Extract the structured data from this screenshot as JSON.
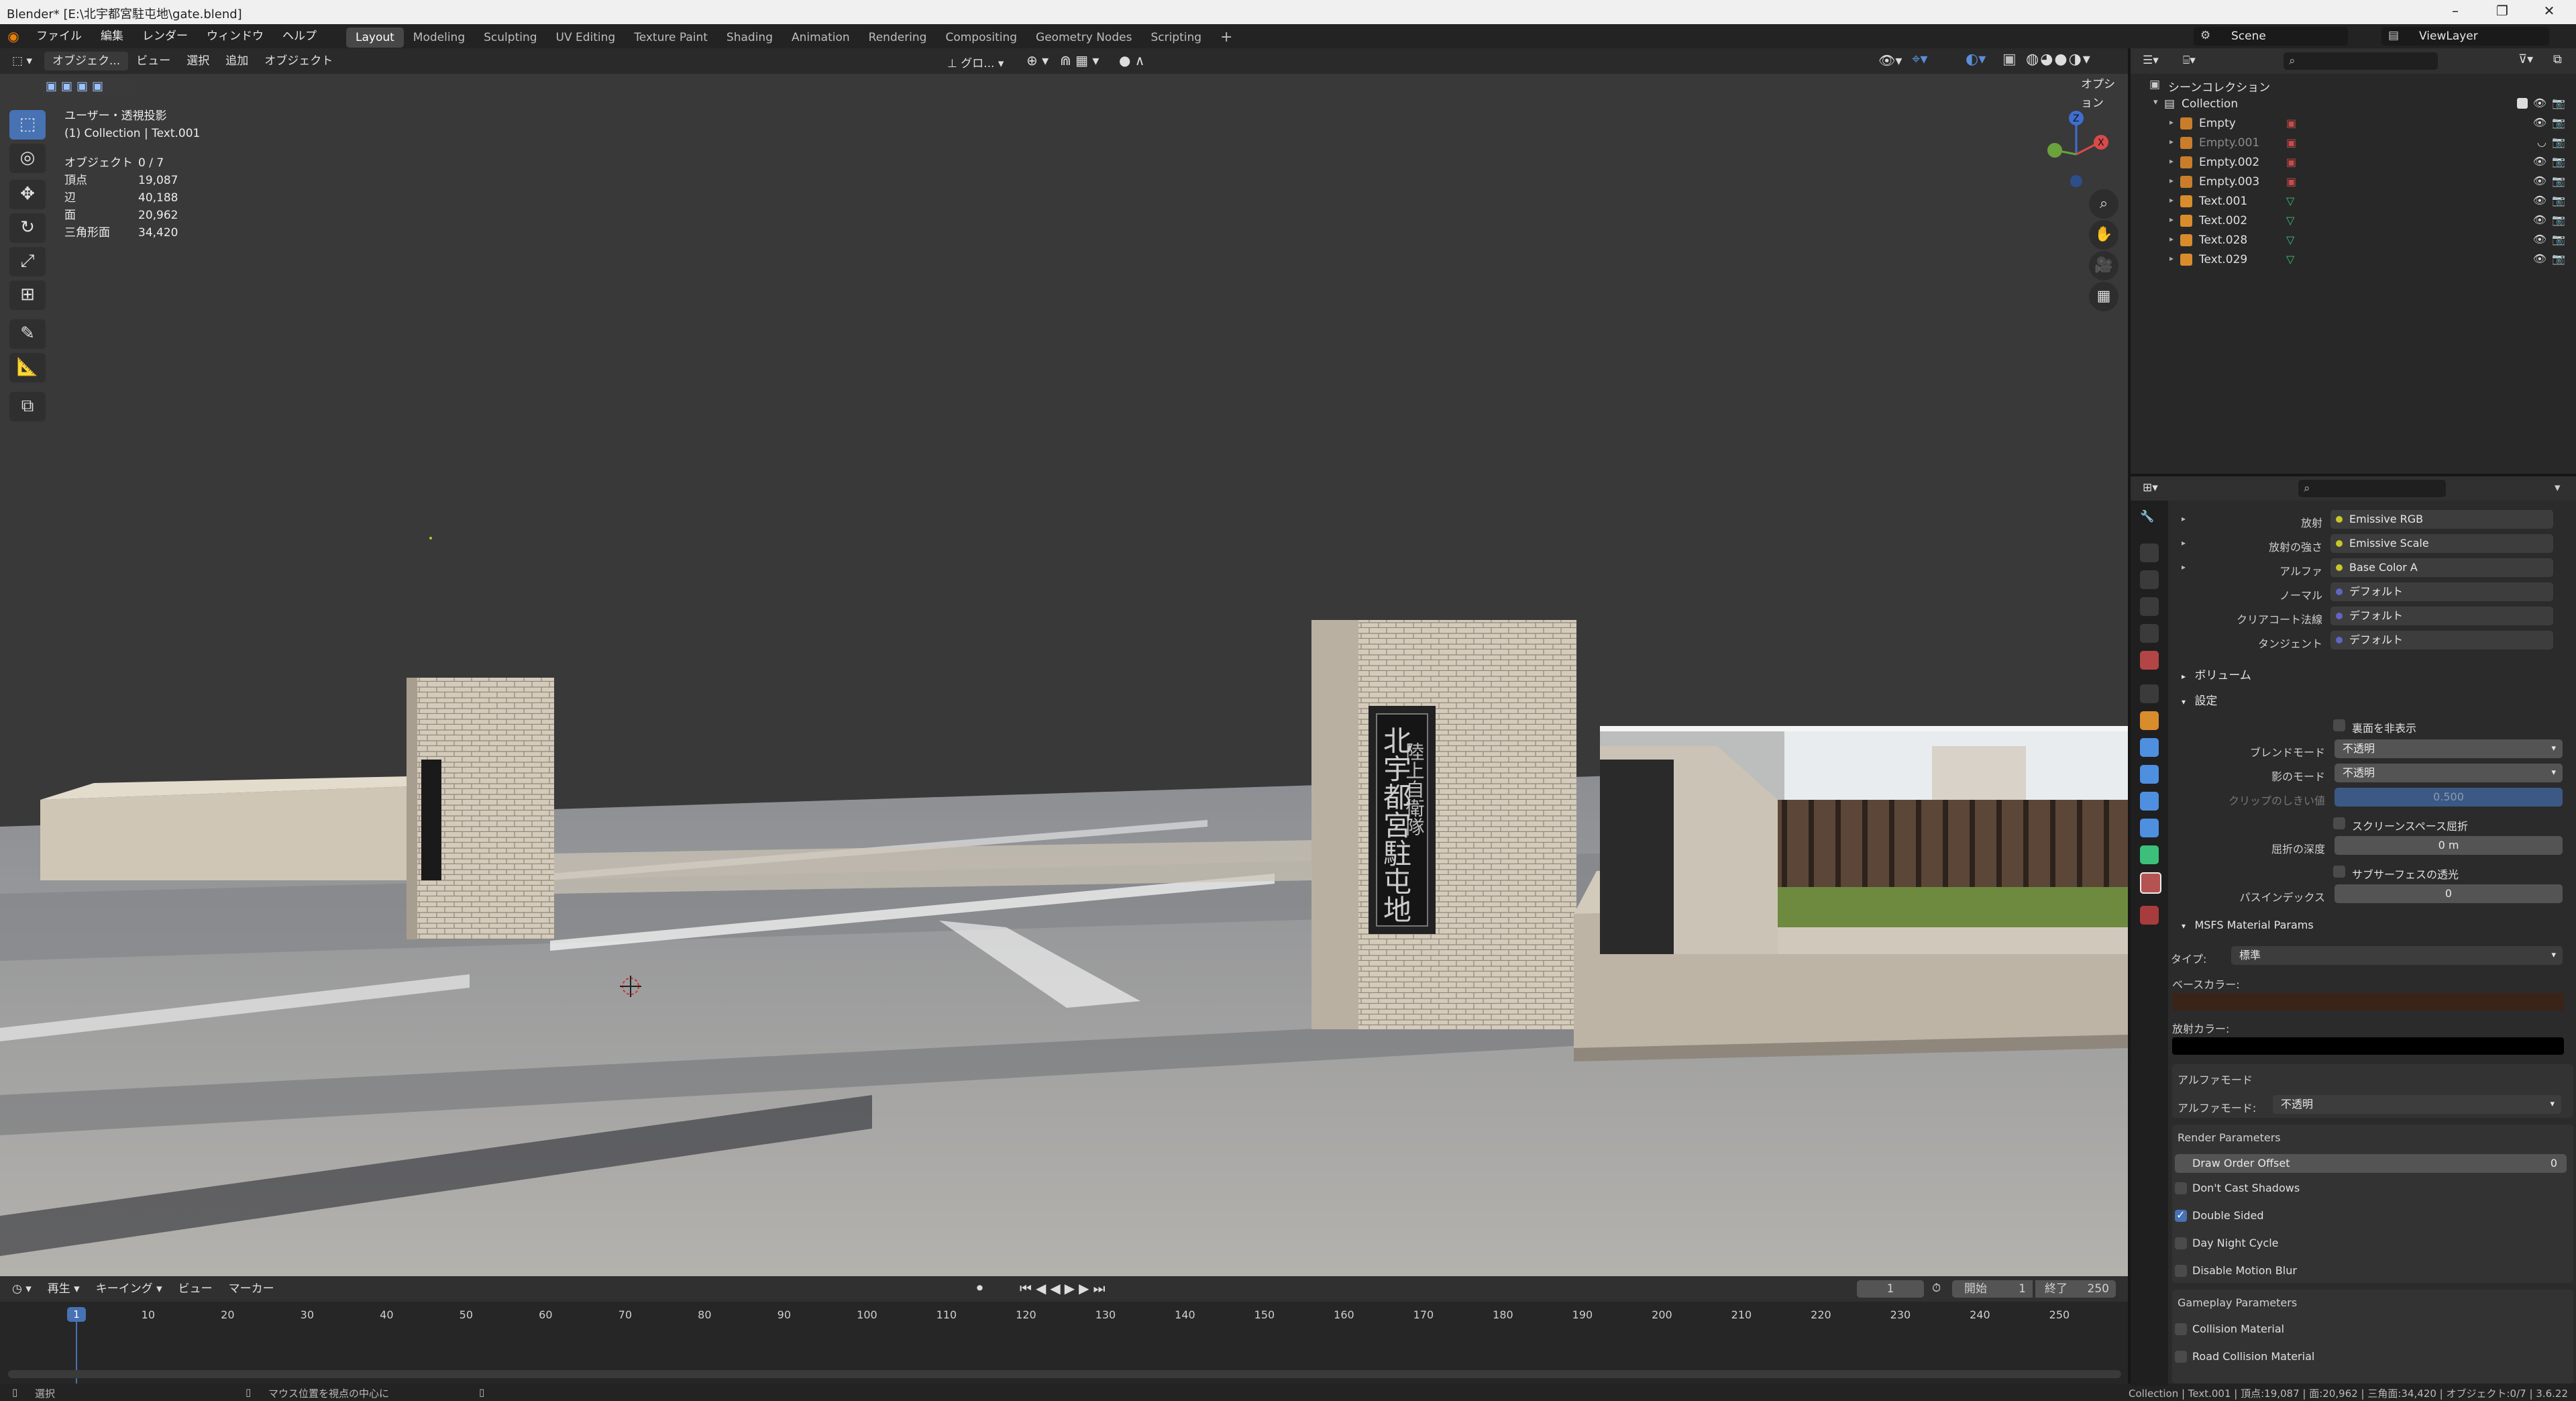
{
  "window": {
    "title": "Blender* [E:\\北宇都宮駐屯地\\gate.blend]"
  },
  "menu": [
    "ファイル",
    "編集",
    "レンダー",
    "ウィンドウ",
    "ヘルプ"
  ],
  "workspaces": [
    "Layout",
    "Modeling",
    "Sculpting",
    "UV Editing",
    "Texture Paint",
    "Shading",
    "Animation",
    "Rendering",
    "Compositing",
    "Geometry Nodes",
    "Scripting"
  ],
  "scene": {
    "name": "Scene",
    "view_layer": "ViewLayer"
  },
  "viewport": {
    "mode": "オブジェク...",
    "menus": [
      "ビュー",
      "選択",
      "追加",
      "オブジェクト"
    ],
    "orientation": "グロ...",
    "options": "オプション",
    "view_label": "ユーザー・透視投影",
    "context": "(1) Collection | Text.001",
    "stats": {
      "objects_label": "オブジェクト",
      "objects": "0 / 7",
      "verts_label": "頂点",
      "verts": "19,087",
      "edges_label": "辺",
      "edges": "40,188",
      "faces_label": "面",
      "faces": "20,962",
      "tris_label": "三角形面",
      "tris": "34,420"
    },
    "gizmo": {
      "z": "Z",
      "x": "X"
    },
    "sign_text": "陸上自衛隊 北宇都宮駐屯地",
    "sign_main": "北宇都宮駐屯地",
    "sign_top": "陸上自衛隊"
  },
  "timeline": {
    "menus": [
      "再生",
      "キーイング",
      "ビュー",
      "マーカー"
    ],
    "current_frame": "1",
    "start_label": "開始",
    "start": "1",
    "end_label": "終了",
    "end": "250",
    "ruler": [
      "1",
      "10",
      "20",
      "30",
      "40",
      "50",
      "60",
      "70",
      "80",
      "90",
      "100",
      "110",
      "120",
      "130",
      "140",
      "150",
      "160",
      "170",
      "180",
      "190",
      "200",
      "210",
      "220",
      "230",
      "240",
      "250"
    ]
  },
  "status": {
    "left": "選択",
    "middle": "マウス位置を視点の中心に",
    "right": "Collection | Text.001 | 頂点:19,087 | 面:20,962 | 三角面:34,420 | オブジェクト:0/7 | 3.6.22"
  },
  "outliner": {
    "scene_collection": "シーンコレクション",
    "collection": "Collection",
    "items": [
      {
        "name": "Empty",
        "type": "empty"
      },
      {
        "name": "Empty.001",
        "type": "empty"
      },
      {
        "name": "Empty.002",
        "type": "empty"
      },
      {
        "name": "Empty.003",
        "type": "empty"
      },
      {
        "name": "Text.001",
        "type": "text"
      },
      {
        "name": "Text.002",
        "type": "text"
      },
      {
        "name": "Text.028",
        "type": "text"
      },
      {
        "name": "Text.029",
        "type": "text"
      }
    ]
  },
  "properties": {
    "sockets": [
      {
        "label": "放射",
        "value": "Emissive RGB"
      },
      {
        "label": "放射の強さ",
        "value": "Emissive Scale"
      },
      {
        "label": "アルファ",
        "value": "Base Color A"
      },
      {
        "label": "ノーマル",
        "value": "デフォルト"
      },
      {
        "label": "クリアコート法線",
        "value": "デフォルト"
      },
      {
        "label": "タンジェント",
        "value": "デフォルト"
      }
    ],
    "volume_section": "ボリューム",
    "settings_section": "設定",
    "backface_label": "裏面を非表示",
    "blend_mode_label": "ブレンドモード",
    "blend_mode": "不透明",
    "shadow_mode_label": "影のモード",
    "shadow_mode": "不透明",
    "clip_label": "クリップのしきい値",
    "clip_value": "0.500",
    "ssr_label": "スクリーンスペース屈折",
    "refraction_depth_label": "屈折の深度",
    "refraction_depth": "0 m",
    "subsurface_label": "サブサーフェスの透光",
    "pass_index_label": "パスインデックス",
    "pass_index": "0",
    "msfs_section": "MSFS Material Params",
    "type_label": "タイプ:",
    "type_value": "標準",
    "base_color_label": "ベースカラー:",
    "base_color": "#3a2418",
    "emissive_color_label": "放射カラー:",
    "emissive_color": "#000000",
    "alpha_mode_section": "アルファモード",
    "alpha_mode_label": "アルファモード:",
    "alpha_mode": "不透明",
    "render_params_section": "Render Parameters",
    "draw_order_label": "Draw Order Offset",
    "draw_order": "0",
    "checks": [
      {
        "label": "Don't Cast Shadows",
        "checked": false
      },
      {
        "label": "Double Sided",
        "checked": true
      },
      {
        "label": "Day Night Cycle",
        "checked": false
      },
      {
        "label": "Disable Motion Blur",
        "checked": false
      }
    ],
    "gameplay_section": "Gameplay Parameters",
    "gameplay_checks": [
      {
        "label": "Collision Material",
        "checked": false
      },
      {
        "label": "Road Collision Material",
        "checked": false
      }
    ]
  }
}
